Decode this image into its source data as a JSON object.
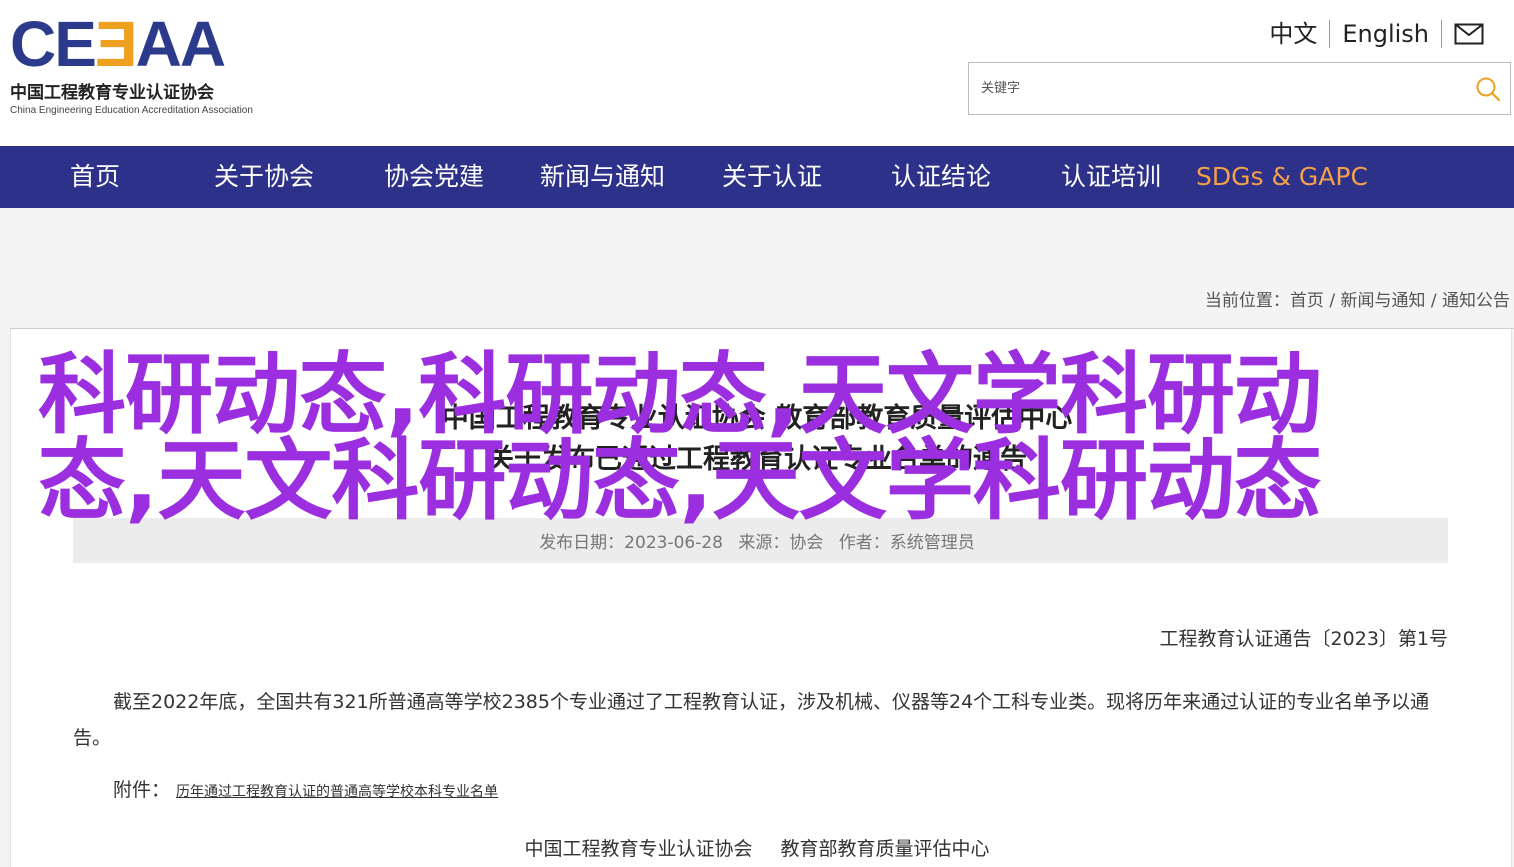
{
  "logo": {
    "mark_left": "CE",
    "mark_mid": "Ǝ",
    "mark_right": "AA",
    "cn": "中国工程教育专业认证协会",
    "en": "China Engineering Education Accreditation Association"
  },
  "lang": {
    "cn": "中文",
    "en": "English"
  },
  "search": {
    "placeholder": "关键字"
  },
  "nav": {
    "items": [
      "首页",
      "关于协会",
      "协会党建",
      "新闻与通知",
      "关于认证",
      "认证结论",
      "认证培训",
      "SDGs & GAPC"
    ]
  },
  "breadcrumb": "当前位置：首页 / 新闻与通知 / 通知公告",
  "article": {
    "title_line1": "中国工程教育专业认证协会 教育部教育质量评估中心",
    "title_line2": "关于发布已通过工程教育认证专业名单的通告",
    "date_label": "发布日期：2023-06-28",
    "source_label": "来源：协会",
    "author_label": "作者：系统管理员",
    "doc_no": "工程教育认证通告〔2023〕第1号",
    "paragraph": "截至2022年底，全国共有321所普通高等学校2385个专业通过了工程教育认证，涉及机械、仪器等24个工科专业类。现将历年来通过认证的专业名单予以通告。",
    "attach_label": "附件：",
    "attach_link": "历年通过工程教育认证的普通高等学校本科专业名单",
    "sign1": "中国工程教育专业认证协会",
    "sign2": "教育部教育质量评估中心"
  },
  "overlay_text": "科研动态,科研动态,天文学科研动态,天文科研动态,天文学科研动态",
  "colors": {
    "nav_bg": "#2d3189",
    "nav_highlight": "#f5a04a",
    "overlay": "#9b2fe0",
    "logo_blue": "#2c3a8c",
    "logo_orange": "#f0a020"
  }
}
